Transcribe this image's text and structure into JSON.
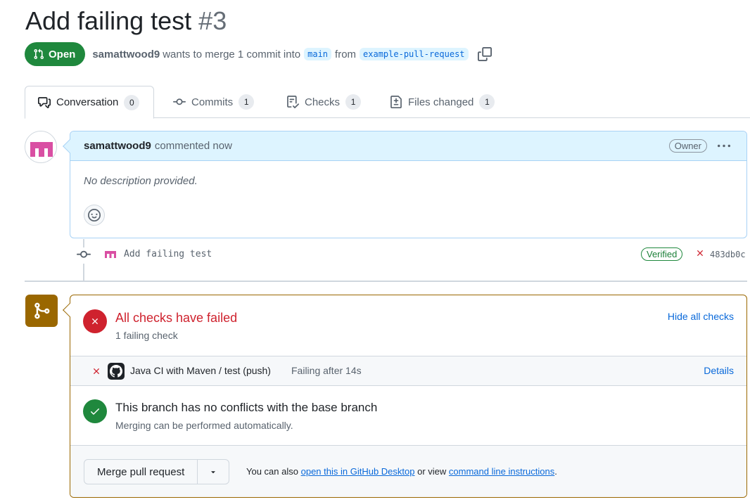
{
  "header": {
    "title": "Add failing test",
    "number": "#3",
    "state": "Open",
    "author": "samattwood9",
    "merge_text": "wants to merge 1 commit into",
    "base_branch": "main",
    "from_text": "from",
    "head_branch": "example-pull-request"
  },
  "tabs": [
    {
      "label": "Conversation",
      "count": "0",
      "icon": "comment-discussion-icon"
    },
    {
      "label": "Commits",
      "count": "1",
      "icon": "git-commit-icon"
    },
    {
      "label": "Checks",
      "count": "1",
      "icon": "checklist-icon"
    },
    {
      "label": "Files changed",
      "count": "1",
      "icon": "file-diff-icon"
    }
  ],
  "comment": {
    "author": "samattwood9",
    "action": "commented now",
    "role": "Owner",
    "body": "No description provided."
  },
  "commit": {
    "message": "Add failing test",
    "verified": "Verified",
    "sha": "483db0c"
  },
  "checks": {
    "title": "All checks have failed",
    "subtitle": "1 failing check",
    "hide_link": "Hide all checks",
    "items": [
      {
        "name": "Java CI with Maven / test (push)",
        "status": "Failing after 14s",
        "link": "Details"
      }
    ]
  },
  "conflicts": {
    "title": "This branch has no conflicts with the base branch",
    "subtitle": "Merging can be performed automatically."
  },
  "merge": {
    "button": "Merge pull request",
    "also_text": "You can also",
    "desktop_link": "open this in GitHub Desktop",
    "or_view": "or view",
    "cli_link": "command line instructions",
    "period": "."
  },
  "colors": {
    "open_green": "#1f883d",
    "fail_red": "#cf222e",
    "link_blue": "#0969da",
    "warning_brown": "#9a6700"
  }
}
